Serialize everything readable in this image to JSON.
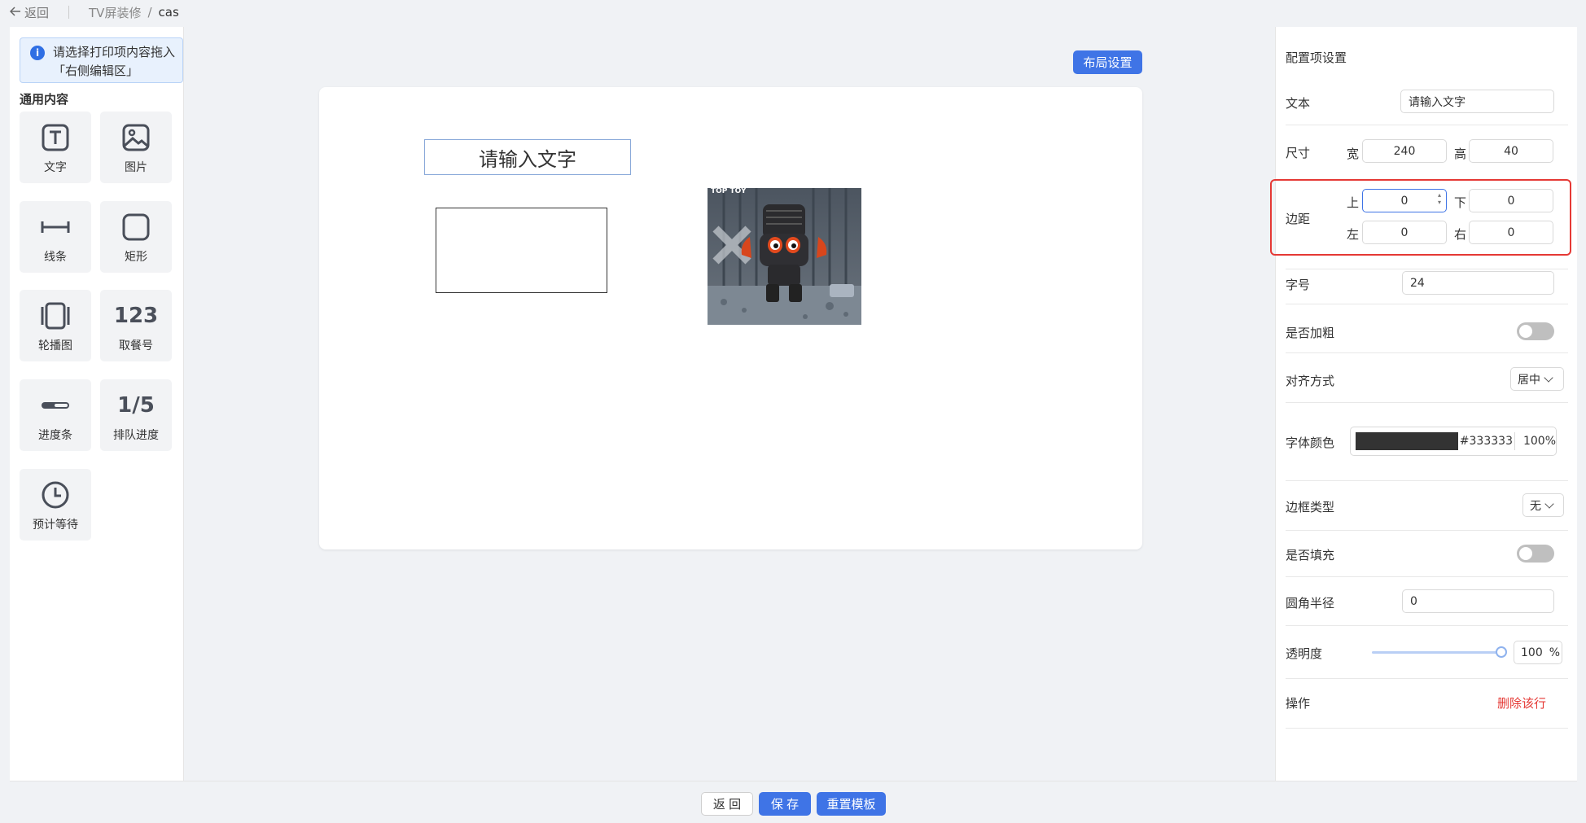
{
  "topbar": {
    "back_label": "返回",
    "crumb_parent": "TV屏装修",
    "crumb_sep": "/",
    "crumb_current": "cas"
  },
  "left": {
    "tip": "请选择打印项内容拖入「右侧编辑区」",
    "section_title": "通用内容",
    "tools": [
      {
        "label": "文字",
        "icon": "text-icon"
      },
      {
        "label": "图片",
        "icon": "image-icon"
      },
      {
        "label": "线条",
        "icon": "line-icon"
      },
      {
        "label": "矩形",
        "icon": "rectangle-icon"
      },
      {
        "label": "轮播图",
        "icon": "carousel-icon"
      },
      {
        "label": "取餐号",
        "icon_text": "123"
      },
      {
        "label": "进度条",
        "icon": "progress-bar-icon"
      },
      {
        "label": "排队进度",
        "icon_text": "1/5"
      },
      {
        "label": "预计等待",
        "icon": "clock-icon"
      }
    ]
  },
  "canvas": {
    "layout_button": "布局设置",
    "text_element": "请输入文字",
    "image_watermark": "TOP TOY"
  },
  "right": {
    "title": "配置项设置",
    "text_label": "文本",
    "text_value": "请输入文字",
    "size_label": "尺寸",
    "width_label": "宽",
    "width_value": "240",
    "height_label": "高",
    "height_value": "40",
    "margin_label": "边距",
    "top_label": "上",
    "top_value": "0",
    "bottom_label": "下",
    "bottom_value": "0",
    "left_label": "左",
    "left_value": "0",
    "right_label": "右",
    "right_value": "0",
    "font_size_label": "字号",
    "font_size_value": "24",
    "bold_label": "是否加粗",
    "bold_on": false,
    "align_label": "对齐方式",
    "align_value": "居中",
    "font_color_label": "字体颜色",
    "font_color_hex": "#333333",
    "font_color_opacity": "100%",
    "border_type_label": "边框类型",
    "border_type_value": "无",
    "fill_label": "是否填充",
    "fill_on": false,
    "radius_label": "圆角半径",
    "radius_value": "0",
    "opacity_label": "透明度",
    "opacity_value": "100",
    "opacity_unit": "%",
    "action_label": "操作",
    "delete_label": "删除该行"
  },
  "bottom": {
    "back_label": "返 回",
    "save_label": "保 存",
    "reset_label": "重置模板"
  },
  "colors": {
    "primary": "#3f74e6",
    "danger": "#e53935",
    "highlight": "#e53935"
  }
}
